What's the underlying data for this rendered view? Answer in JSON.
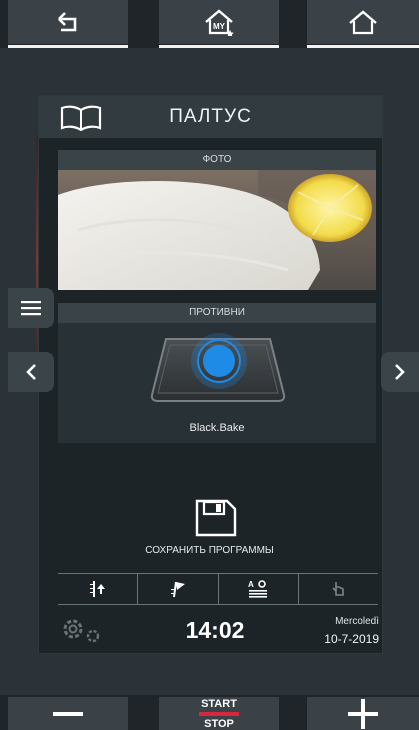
{
  "top": {
    "buttons": [
      {
        "name": "back-button",
        "icon": "back-arrow-icon"
      },
      {
        "name": "my-home-button",
        "icon": "my-home-icon",
        "badge": "MY"
      },
      {
        "name": "home-button",
        "icon": "home-icon"
      }
    ]
  },
  "recipe": {
    "title": "ПАЛТУС",
    "photo_label": "ФОТО",
    "trays_label": "ПРОТИВНИ",
    "tray_name": "Black.Bake",
    "save_label": "СОХРАНИТЬ ПРОГРАММЫ"
  },
  "status": {
    "time": "14:02",
    "day": "Mercoledì",
    "date": "10-7-2019"
  },
  "bottom": {
    "start_label": "START",
    "stop_label": "STOP"
  },
  "colors": {
    "accent_blue": "#1e8ce6",
    "stop_red": "#d6273e"
  }
}
